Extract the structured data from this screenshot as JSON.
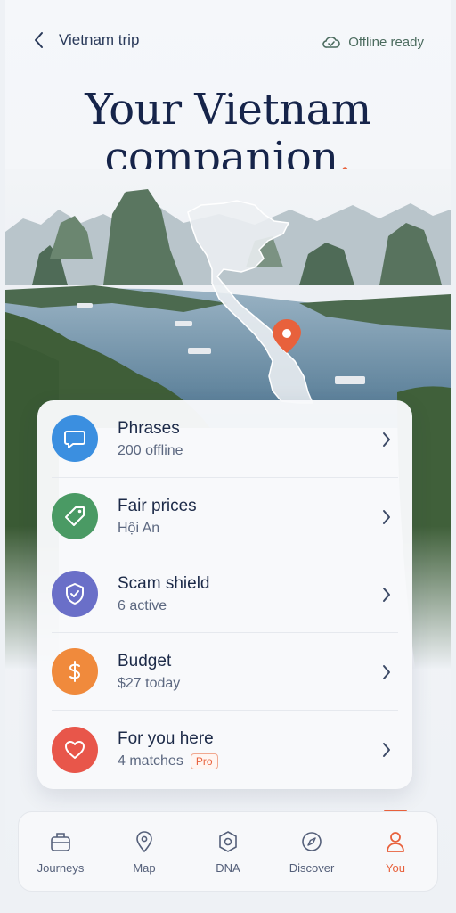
{
  "header": {
    "back_label": "Vietnam trip",
    "status_label": "Offline ready"
  },
  "hero": {
    "headline_line1": "Your Vietnam",
    "headline_line2": "companion",
    "headline_punct": "."
  },
  "features": [
    {
      "title": "Phrases",
      "subtitle": "200 offline",
      "icon": "chat-bubble-icon",
      "color": "#3b8fe0"
    },
    {
      "title": "Fair prices",
      "subtitle": "Hội An",
      "icon": "price-tag-icon",
      "color": "#4a9a64"
    },
    {
      "title": "Scam shield",
      "subtitle": "6 active",
      "icon": "shield-icon",
      "color": "#6a6fc8"
    },
    {
      "title": "Budget",
      "subtitle": "$27 today",
      "icon": "dollar-icon",
      "color": "#f08a3c"
    },
    {
      "title": "For you here",
      "subtitle": "4 matches",
      "badge": "Pro",
      "icon": "heart-icon",
      "color": "#e8564a"
    }
  ],
  "nav": [
    {
      "label": "Journeys",
      "icon": "suitcase-icon"
    },
    {
      "label": "Map",
      "icon": "map-pin-icon"
    },
    {
      "label": "DNA",
      "icon": "hexagon-icon"
    },
    {
      "label": "Discover",
      "icon": "compass-icon"
    },
    {
      "label": "You",
      "icon": "person-icon",
      "active": true
    }
  ],
  "colors": {
    "accent": "#e8613c",
    "navy": "#16244a"
  }
}
